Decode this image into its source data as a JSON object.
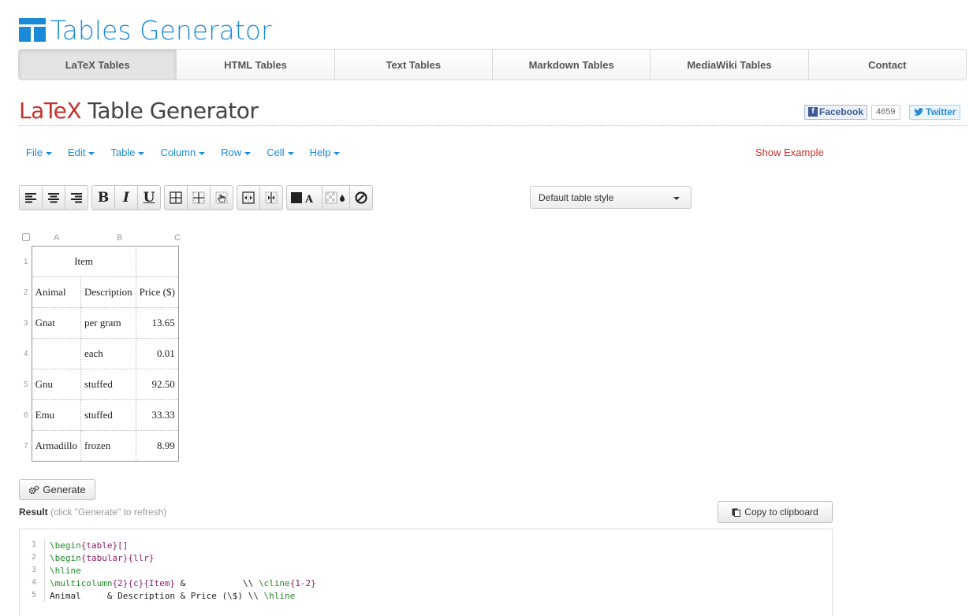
{
  "brand": {
    "name": "Tables Generator",
    "color": "#1a8ad8"
  },
  "nav": {
    "items": [
      {
        "label": "LaTeX Tables",
        "active": true
      },
      {
        "label": "HTML Tables",
        "active": false
      },
      {
        "label": "Text Tables",
        "active": false
      },
      {
        "label": "Markdown Tables",
        "active": false
      },
      {
        "label": "MediaWiki Tables",
        "active": false
      },
      {
        "label": "Contact",
        "active": false
      }
    ]
  },
  "title": {
    "prefix": "LaTeX",
    "rest": " Table Generator",
    "accent_color": "#c5332c"
  },
  "social": {
    "facebook_label": "Facebook",
    "facebook_count": "4659",
    "twitter_label": "Twitter"
  },
  "menu": {
    "items": [
      "File",
      "Edit",
      "Table",
      "Column",
      "Row",
      "Cell",
      "Help"
    ],
    "show_example": "Show Example"
  },
  "toolbar": {
    "icons": [
      "align-left-icon",
      "align-center-icon",
      "align-right-icon",
      "bold-icon",
      "italic-icon",
      "underline-icon",
      "borders-all-icon",
      "borders-inner-icon",
      "borders-edit-icon",
      "merge-cells-icon",
      "split-cells-icon",
      "text-color-icon",
      "background-color-icon",
      "clear-format-icon"
    ],
    "bold": "B",
    "italic": "I",
    "underline": "U",
    "color_letter": "A",
    "style_select": "Default table style"
  },
  "grid": {
    "col_headers": [
      "A",
      "B",
      "C"
    ],
    "row_numbers": [
      "1",
      "2",
      "3",
      "4",
      "5",
      "6",
      "7"
    ],
    "rows": [
      [
        "Item",
        "",
        ""
      ],
      [
        "Animal",
        "Description",
        "Price ($)"
      ],
      [
        "Gnat",
        "per gram",
        "13.65"
      ],
      [
        "",
        "each",
        "0.01"
      ],
      [
        "Gnu",
        "stuffed",
        "92.50"
      ],
      [
        "Emu",
        "stuffed",
        "33.33"
      ],
      [
        "Armadillo",
        "frozen",
        "8.99"
      ]
    ]
  },
  "generate": {
    "label": "Generate"
  },
  "result": {
    "label_bold": "Result",
    "label_hint": " (click \"Generate\" to refresh)",
    "copy_label": "Copy to clipboard"
  },
  "code": {
    "lines": [
      {
        "n": "1",
        "parts": [
          [
            "kw",
            "\\begin"
          ],
          [
            "arg",
            "{table}[]"
          ]
        ]
      },
      {
        "n": "2",
        "parts": [
          [
            "kw",
            "\\begin"
          ],
          [
            "arg",
            "{tabular}{llr}"
          ]
        ]
      },
      {
        "n": "3",
        "parts": [
          [
            "kw",
            "\\hline"
          ]
        ]
      },
      {
        "n": "4",
        "parts": [
          [
            "kw",
            "\\multicolumn"
          ],
          [
            "arg",
            "{2}{c}{Item}"
          ],
          [
            "",
            " &           \\\\ "
          ],
          [
            "kw",
            "\\cline"
          ],
          [
            "arg",
            "{1-2}"
          ]
        ]
      },
      {
        "n": "5",
        "parts": [
          [
            "",
            "Animal     & Description & Price (\\$) \\\\ "
          ],
          [
            "kw",
            "\\hline"
          ]
        ]
      }
    ]
  }
}
